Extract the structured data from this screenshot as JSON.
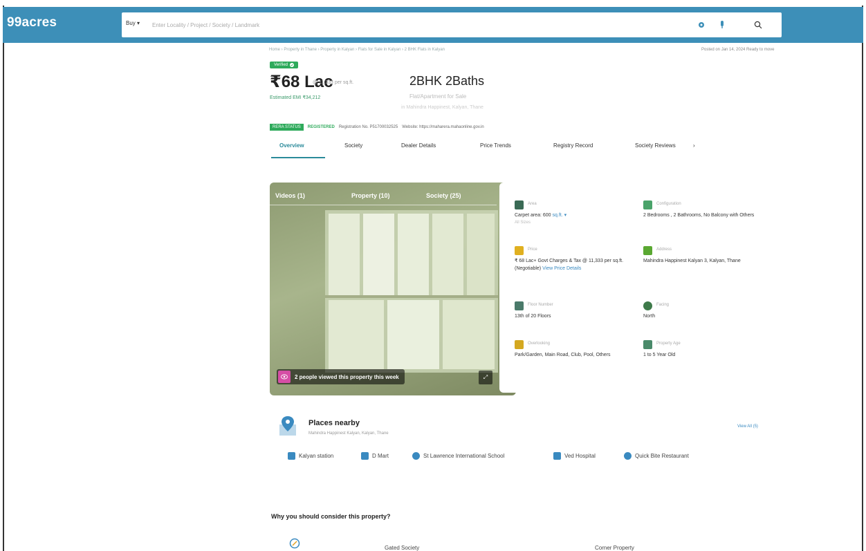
{
  "header": {
    "logo": "99acres",
    "buy_label": "Buy ▾",
    "search_placeholder": "Enter Locality / Project / Society / Landmark"
  },
  "breadcrumb": "Home › Property in Thane › Property in Kalyan › Flats for Sale in Kalyan › 2 BHK Flats in Kalyan",
  "posted": "Posted on Jan 14, 2024    Ready to move",
  "listing": {
    "verified": "Verified",
    "price": "₹68 Lac",
    "price_per_sqft": "@ 11,333 per sq.ft.",
    "emi": "Estimated EMI ₹34,212",
    "title": "2BHK 2Baths",
    "subtitle": "Flat/Apartment for Sale",
    "subtitle2": "in Mahindra Happinest, Kalyan, Thane"
  },
  "rera": {
    "status_label": "RERA STATUS",
    "registered": "REGISTERED",
    "reg_no": "Registration No. P51700032525",
    "website": "Website: https://maharera.mahaonline.gov.in"
  },
  "tabs": [
    {
      "label": "Overview"
    },
    {
      "label": "Society"
    },
    {
      "label": "Dealer Details"
    },
    {
      "label": "Price Trends"
    },
    {
      "label": "Registry Record"
    },
    {
      "label": "Society Reviews"
    }
  ],
  "gallery": {
    "tabs": [
      "Videos (1)",
      "Property (10)",
      "Society (25)"
    ],
    "viewed_text": "2 people viewed this property this week",
    "expand_label": "⤢"
  },
  "details": {
    "area": {
      "label": "Area",
      "value": "Carpet area: 600",
      "unit": "sq.ft. ▾",
      "sub": "All Sizes"
    },
    "config": {
      "label": "Configuration",
      "value": "2 Bedrooms , 2 Bathrooms, No Balcony with Others"
    },
    "price": {
      "label": "Price",
      "value": "₹ 68 Lac+ Govt Charges & Tax @ 11,333 per sq.ft. (Negotiable)",
      "link": "View Price Details"
    },
    "address": {
      "label": "Address",
      "value": "Mahindra Happinest Kalyan 3, Kalyan, Thane"
    },
    "floor": {
      "label": "Floor Number",
      "value": "13th of 20 Floors"
    },
    "facing": {
      "label": "Facing",
      "value": "North"
    },
    "overlooking": {
      "label": "Overlooking",
      "value": "Park/Garden, Main Road, Club, Pool, Others"
    },
    "age": {
      "label": "Property Age",
      "value": "1 to 5 Year Old"
    }
  },
  "places": {
    "title": "Places nearby",
    "subtitle": "Mahindra Happinest Kalyan, Kalyan, Thane",
    "view_all": "View All (5)",
    "items": [
      "Kalyan station",
      "D Mart",
      "St Lawrence International School",
      "Ved Hospital",
      "Quick Bite Restaurant"
    ]
  },
  "why": {
    "title": "Why you should consider this property?",
    "item1": "Gated Society",
    "item2": "Corner Property"
  },
  "colors": {
    "header": "#3d8fb8",
    "green": "#2eaa5b",
    "tab_active": "#2a8a9a"
  }
}
